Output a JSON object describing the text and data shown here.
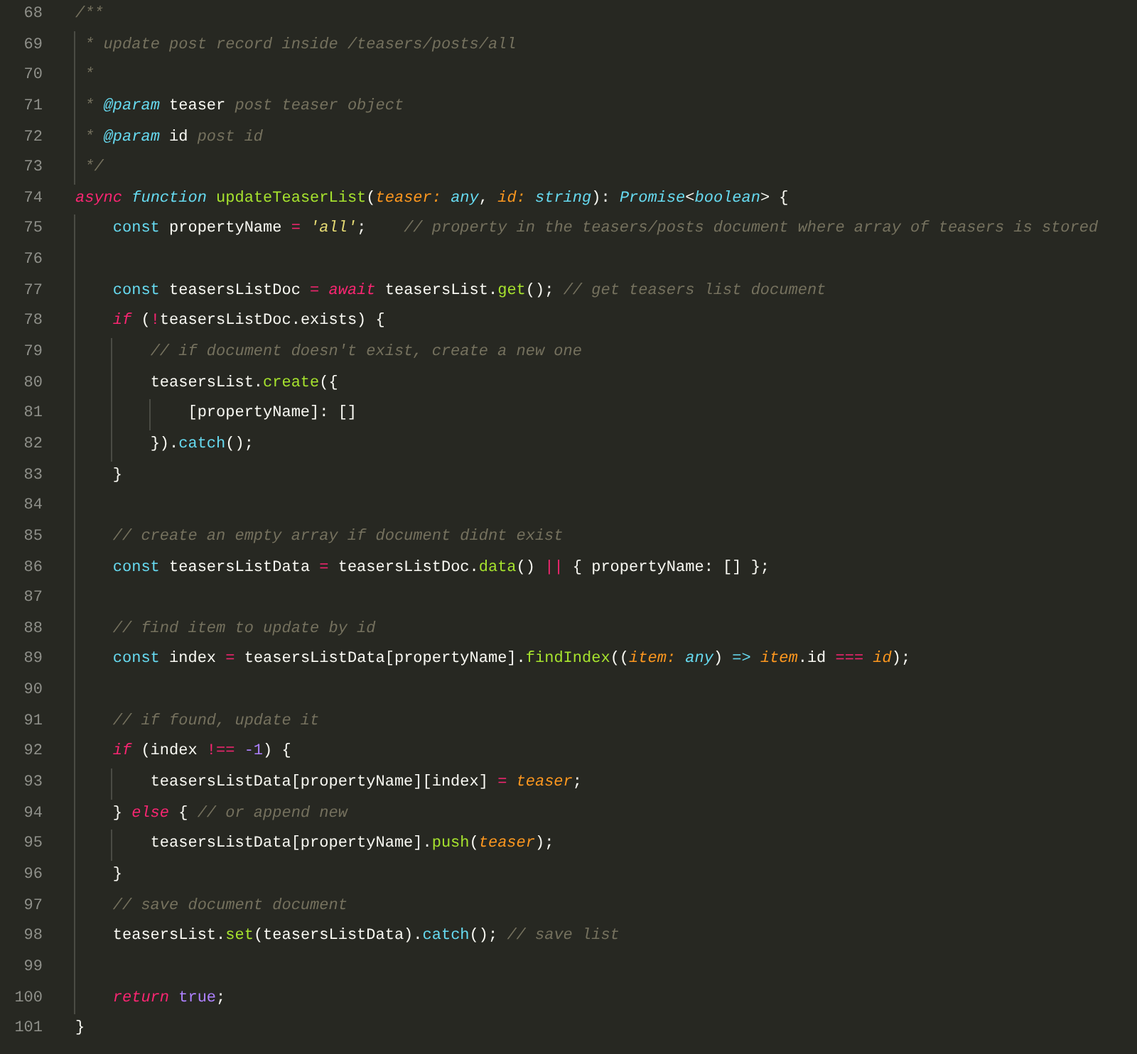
{
  "editor": {
    "lines": [
      {
        "number": "68",
        "tokens": [
          {
            "text": "/**",
            "kind": "comment"
          }
        ]
      },
      {
        "number": "69",
        "tokens": [
          {
            "text": " * update post record inside /teasers/posts/all",
            "kind": "comment"
          }
        ]
      },
      {
        "number": "70",
        "tokens": [
          {
            "text": " *",
            "kind": "comment"
          }
        ]
      },
      {
        "number": "71",
        "tokens": [
          {
            "text": " * ",
            "kind": "comment"
          },
          {
            "text": "@param",
            "kind": "storage"
          },
          {
            "text": " teaser ",
            "kind": "plain"
          },
          {
            "text": "post teaser object",
            "kind": "comment"
          }
        ]
      },
      {
        "number": "72",
        "tokens": [
          {
            "text": " * ",
            "kind": "comment"
          },
          {
            "text": "@param",
            "kind": "storage"
          },
          {
            "text": " id ",
            "kind": "plain"
          },
          {
            "text": "post id",
            "kind": "comment"
          }
        ]
      },
      {
        "number": "73",
        "tokens": [
          {
            "text": " */",
            "kind": "comment"
          }
        ]
      },
      {
        "number": "74",
        "tokens": [
          {
            "text": "async",
            "kind": "keyword"
          },
          {
            "text": " function",
            "kind": "storage"
          },
          {
            "text": " updateTeaserList",
            "kind": "function"
          },
          {
            "text": "(",
            "kind": "plain"
          },
          {
            "text": "teaser:",
            "kind": "param"
          },
          {
            "text": " any",
            "kind": "type"
          },
          {
            "text": ", ",
            "kind": "plain"
          },
          {
            "text": "id:",
            "kind": "param"
          },
          {
            "text": " string",
            "kind": "type"
          },
          {
            "text": "): ",
            "kind": "plain"
          },
          {
            "text": "Promise",
            "kind": "type"
          },
          {
            "text": "<",
            "kind": "plain"
          },
          {
            "text": "boolean",
            "kind": "type"
          },
          {
            "text": "> {",
            "kind": "plain"
          }
        ]
      },
      {
        "number": "75",
        "tokens": [
          {
            "text": "    const",
            "kind": "declaration"
          },
          {
            "text": " propertyName ",
            "kind": "plain"
          },
          {
            "text": "=",
            "kind": "operator"
          },
          {
            "text": " 'all'",
            "kind": "string"
          },
          {
            "text": ";    ",
            "kind": "plain"
          },
          {
            "text": "// property in the teasers/posts document where array of teasers is stored",
            "kind": "comment"
          }
        ]
      },
      {
        "number": "76"
      },
      {
        "number": "77",
        "tokens": [
          {
            "text": "    const",
            "kind": "declaration"
          },
          {
            "text": " teasersListDoc ",
            "kind": "plain"
          },
          {
            "text": "=",
            "kind": "operator"
          },
          {
            "text": " await",
            "kind": "keyword"
          },
          {
            "text": " teasersList.",
            "kind": "plain"
          },
          {
            "text": "get",
            "kind": "function"
          },
          {
            "text": "(); ",
            "kind": "plain"
          },
          {
            "text": "// get teasers list document",
            "kind": "comment"
          }
        ]
      },
      {
        "number": "78",
        "tokens": [
          {
            "text": "    if",
            "kind": "keyword"
          },
          {
            "text": " (",
            "kind": "plain"
          },
          {
            "text": "!",
            "kind": "operator"
          },
          {
            "text": "teasersListDoc.exists) {",
            "kind": "plain"
          }
        ]
      },
      {
        "number": "79",
        "tokens": [
          {
            "text": "        // if document doesn't exist, create a new one",
            "kind": "comment"
          }
        ]
      },
      {
        "number": "80",
        "tokens": [
          {
            "text": "        teasersList.",
            "kind": "plain"
          },
          {
            "text": "create",
            "kind": "function"
          },
          {
            "text": "({",
            "kind": "plain"
          }
        ]
      },
      {
        "number": "81",
        "tokens": [
          {
            "text": "            [propertyName]: []",
            "kind": "plain"
          }
        ]
      },
      {
        "number": "82",
        "tokens": [
          {
            "text": "        }).",
            "kind": "plain"
          },
          {
            "text": "catch",
            "kind": "builtin"
          },
          {
            "text": "();",
            "kind": "plain"
          }
        ]
      },
      {
        "number": "83",
        "tokens": [
          {
            "text": "    }",
            "kind": "plain"
          }
        ]
      },
      {
        "number": "84"
      },
      {
        "number": "85",
        "tokens": [
          {
            "text": "    // create an empty array if document didnt exist",
            "kind": "comment"
          }
        ]
      },
      {
        "number": "86",
        "tokens": [
          {
            "text": "    const",
            "kind": "declaration"
          },
          {
            "text": " teasersListData ",
            "kind": "plain"
          },
          {
            "text": "=",
            "kind": "operator"
          },
          {
            "text": " teasersListDoc.",
            "kind": "plain"
          },
          {
            "text": "data",
            "kind": "function"
          },
          {
            "text": "() ",
            "kind": "plain"
          },
          {
            "text": "||",
            "kind": "operator"
          },
          {
            "text": " { propertyName: [] };",
            "kind": "plain"
          }
        ]
      },
      {
        "number": "87"
      },
      {
        "number": "88",
        "tokens": [
          {
            "text": "    // find item to update by id",
            "kind": "comment"
          }
        ]
      },
      {
        "number": "89",
        "tokens": [
          {
            "text": "    const",
            "kind": "declaration"
          },
          {
            "text": " index ",
            "kind": "plain"
          },
          {
            "text": "=",
            "kind": "operator"
          },
          {
            "text": " teasersListData[propertyName].",
            "kind": "plain"
          },
          {
            "text": "findIndex",
            "kind": "function"
          },
          {
            "text": "((",
            "kind": "plain"
          },
          {
            "text": "item:",
            "kind": "param"
          },
          {
            "text": " any",
            "kind": "type"
          },
          {
            "text": ") ",
            "kind": "plain"
          },
          {
            "text": "=>",
            "kind": "builtin"
          },
          {
            "text": " item",
            "kind": "param"
          },
          {
            "text": ".id ",
            "kind": "plain"
          },
          {
            "text": "===",
            "kind": "operator"
          },
          {
            "text": " id",
            "kind": "param"
          },
          {
            "text": ");",
            "kind": "plain"
          }
        ]
      },
      {
        "number": "90"
      },
      {
        "number": "91",
        "tokens": [
          {
            "text": "    // if found, update it",
            "kind": "comment"
          }
        ]
      },
      {
        "number": "92",
        "tokens": [
          {
            "text": "    if",
            "kind": "keyword"
          },
          {
            "text": " (index ",
            "kind": "plain"
          },
          {
            "text": "!==",
            "kind": "operator"
          },
          {
            "text": " -1",
            "kind": "constant"
          },
          {
            "text": ") {",
            "kind": "plain"
          }
        ]
      },
      {
        "number": "93",
        "tokens": [
          {
            "text": "        teasersListData[propertyName][index] ",
            "kind": "plain"
          },
          {
            "text": "=",
            "kind": "operator"
          },
          {
            "text": " teaser",
            "kind": "param"
          },
          {
            "text": ";",
            "kind": "plain"
          }
        ]
      },
      {
        "number": "94",
        "tokens": [
          {
            "text": "    } ",
            "kind": "plain"
          },
          {
            "text": "else",
            "kind": "keyword"
          },
          {
            "text": " { ",
            "kind": "plain"
          },
          {
            "text": "// or append new",
            "kind": "comment"
          }
        ]
      },
      {
        "number": "95",
        "tokens": [
          {
            "text": "        teasersListData[propertyName].",
            "kind": "plain"
          },
          {
            "text": "push",
            "kind": "function"
          },
          {
            "text": "(",
            "kind": "plain"
          },
          {
            "text": "teaser",
            "kind": "param"
          },
          {
            "text": ");",
            "kind": "plain"
          }
        ]
      },
      {
        "number": "96",
        "tokens": [
          {
            "text": "    }",
            "kind": "plain"
          }
        ]
      },
      {
        "number": "97",
        "tokens": [
          {
            "text": "    // save document document",
            "kind": "comment"
          }
        ]
      },
      {
        "number": "98",
        "tokens": [
          {
            "text": "    teasersList.",
            "kind": "plain"
          },
          {
            "text": "set",
            "kind": "function"
          },
          {
            "text": "(teasersListData).",
            "kind": "plain"
          },
          {
            "text": "catch",
            "kind": "builtin"
          },
          {
            "text": "(); ",
            "kind": "plain"
          },
          {
            "text": "// save list",
            "kind": "comment"
          }
        ]
      },
      {
        "number": "99"
      },
      {
        "number": "100",
        "tokens": [
          {
            "text": "    return",
            "kind": "keyword"
          },
          {
            "text": " true",
            "kind": "constant"
          },
          {
            "text": ";",
            "kind": "plain"
          }
        ]
      },
      {
        "number": "101",
        "tokens": [
          {
            "text": "}",
            "kind": "plain"
          }
        ]
      }
    ]
  }
}
